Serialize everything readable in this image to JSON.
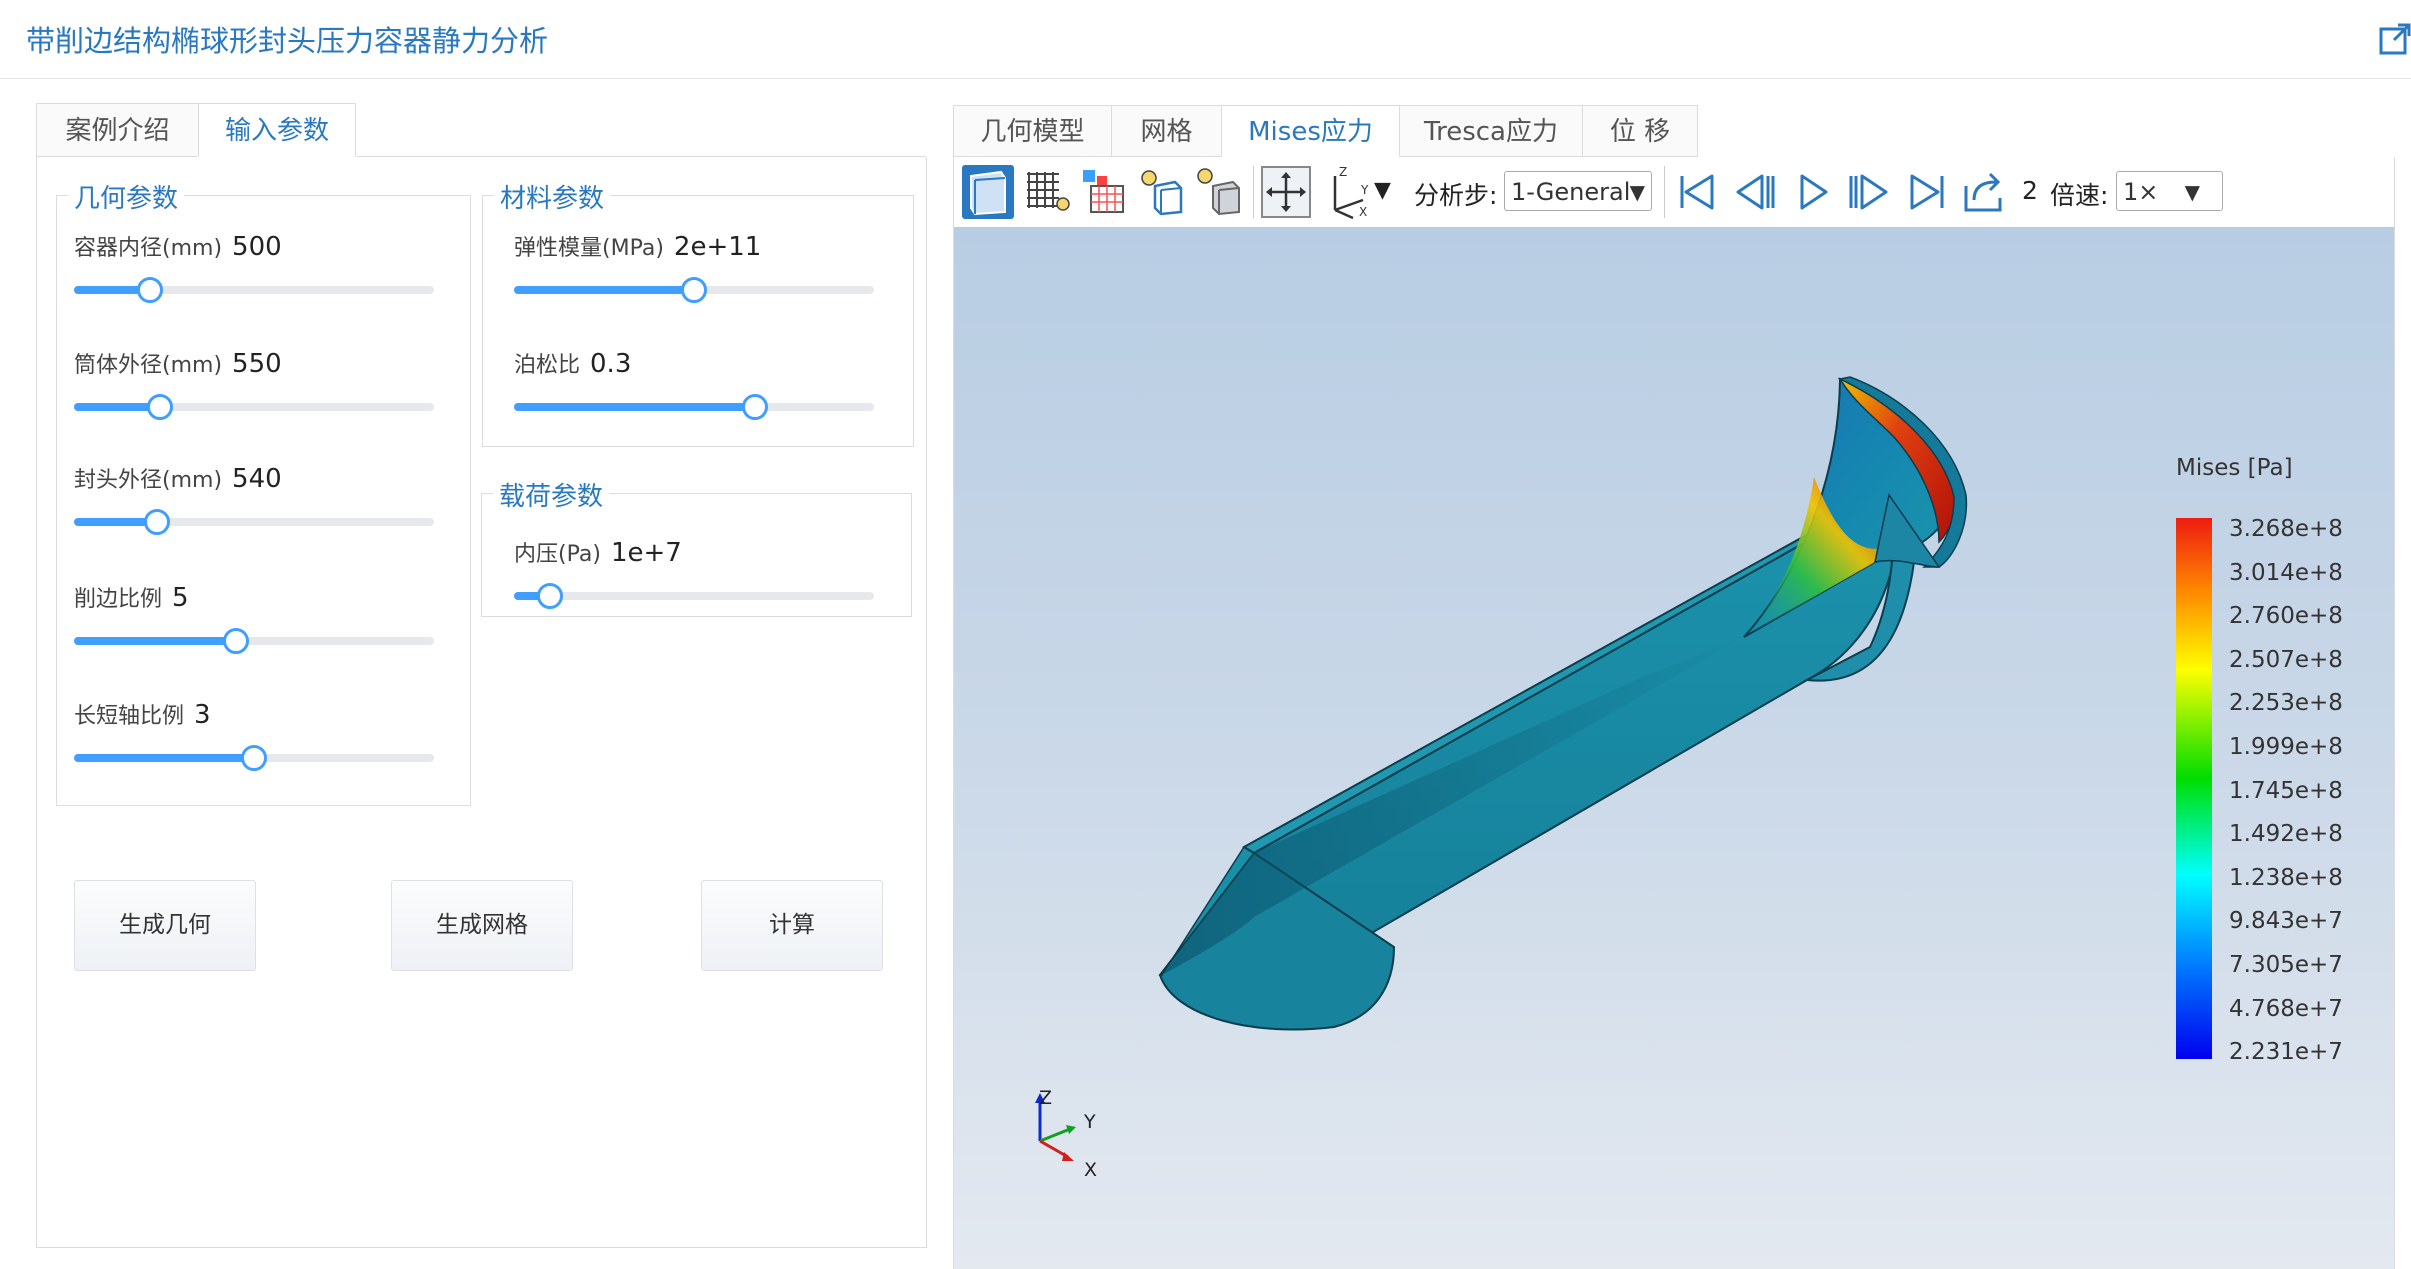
{
  "header": {
    "title": "带削边结构椭球形封头压力容器静力分析",
    "external_link_icon": "external-link-icon"
  },
  "left_tabs": {
    "intro": "案例介绍",
    "input": "输入参数"
  },
  "geometry": {
    "title": "几何参数",
    "params": [
      {
        "label": "容器内径(mm)",
        "value": "500",
        "fraction": 0.21
      },
      {
        "label": "筒体外径(mm)",
        "value": "550",
        "fraction": 0.24
      },
      {
        "label": "封头外径(mm)",
        "value": "540",
        "fraction": 0.23
      },
      {
        "label": "削边比例",
        "value": "5",
        "fraction": 0.45
      },
      {
        "label": "长短轴比例",
        "value": "3",
        "fraction": 0.5
      }
    ]
  },
  "material": {
    "title": "材料参数",
    "params": [
      {
        "label": "弹性模量(MPa)",
        "value": "2e+11",
        "fraction": 0.5
      },
      {
        "label": "泊松比",
        "value": "0.3",
        "fraction": 0.67
      }
    ]
  },
  "load": {
    "title": "载荷参数",
    "params": [
      {
        "label": "内压(Pa)",
        "value": "1e+7",
        "fraction": 0.1
      }
    ]
  },
  "buttons": {
    "gen_geometry": "生成几何",
    "gen_mesh": "生成网格",
    "compute": "计算"
  },
  "result_tabs": [
    "几何模型",
    "网格",
    "Mises应力",
    "Tresca应力",
    "位 移"
  ],
  "toolbar": {
    "step_label": "分析步:",
    "step_value": "1-General",
    "frame": "2",
    "speed_label": "倍速:",
    "speed_value": "1×"
  },
  "legend": {
    "title": "Mises [Pa]",
    "values": [
      "3.268e+8",
      "3.014e+8",
      "2.760e+8",
      "2.507e+8",
      "2.253e+8",
      "1.999e+8",
      "1.745e+8",
      "1.492e+8",
      "1.238e+8",
      "9.843e+7",
      "7.305e+7",
      "4.768e+7",
      "2.231e+7"
    ]
  },
  "triad": {
    "z": "Z",
    "y": "Y",
    "x": "X"
  },
  "colors": {
    "accent": "#2a79c0",
    "slider": "#409eff"
  }
}
